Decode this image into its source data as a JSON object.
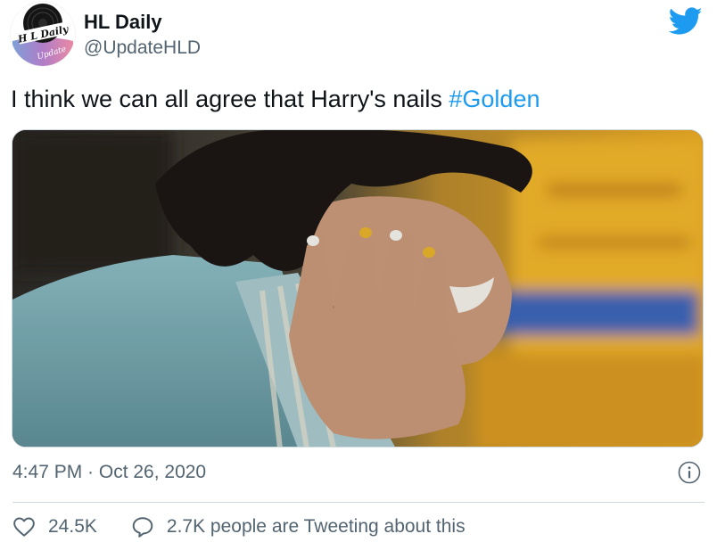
{
  "author": {
    "display_name": "HL Daily",
    "handle": "@UpdateHLD",
    "avatar_text_top": "H L Daily",
    "avatar_text_bottom": "Update"
  },
  "tweet": {
    "text": "I think we can all agree that Harry's nails ",
    "hashtag": "#Golden",
    "timestamp": "4:47 PM · Oct 26, 2020"
  },
  "stats": {
    "likes": "24.5K",
    "tweeting": "2.7K people are Tweeting about this"
  },
  "icons": {
    "brand": "twitter-bird-icon",
    "info": "info-icon",
    "like": "heart-icon",
    "reply": "speech-bubble-icon"
  },
  "colors": {
    "brand_blue": "#1d9bf0",
    "text_primary": "#0f1419",
    "text_secondary": "#536471",
    "divider": "#cfd9de"
  }
}
